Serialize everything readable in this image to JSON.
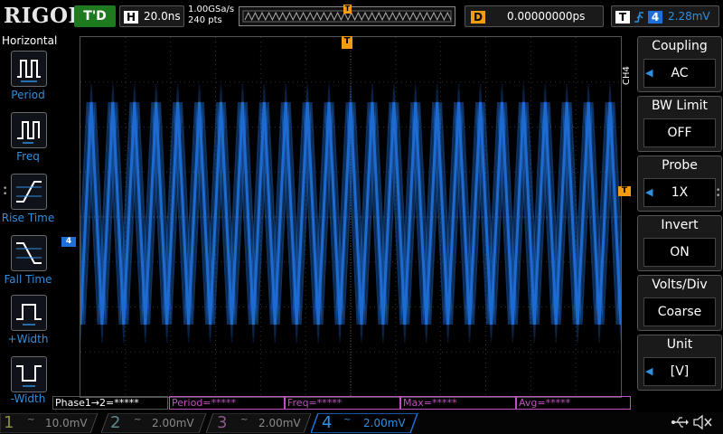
{
  "topbar": {
    "logo": "RIGOL",
    "run_status": "T'D",
    "horizontal": {
      "letter": "H",
      "timebase": "20.0ns"
    },
    "acquisition": {
      "sample_rate": "1.00GSa/s",
      "points": "240 pts"
    },
    "memory_trigger_marker": "T",
    "delay": {
      "letter": "D",
      "value": "0.00000000ps"
    },
    "trigger": {
      "letter": "T",
      "source": "4",
      "level": "2.28mV"
    }
  },
  "left_menu": {
    "title": "Horizontal",
    "items": [
      {
        "label": "Period",
        "icon": "period-icon"
      },
      {
        "label": "Freq",
        "icon": "frequency-icon"
      },
      {
        "label": "Rise Time",
        "icon": "rise-time-icon"
      },
      {
        "label": "Fall Time",
        "icon": "fall-time-icon"
      },
      {
        "label": "+Width",
        "icon": "positive-width-icon"
      },
      {
        "label": "-Width",
        "icon": "negative-width-icon"
      }
    ]
  },
  "screen": {
    "channel_marker": "4",
    "trigger_level_marker": "T",
    "trigger_position_marker": "T",
    "trace_color": "#1f6fd8",
    "waveform": {
      "shape": "triangle",
      "cycles_on_screen": 25
    }
  },
  "measurements": [
    {
      "text": "Phase1→2=*****",
      "color": "#ffffff"
    },
    {
      "text": "Period=*****",
      "color": "#c050c0"
    },
    {
      "text": "Freq=*****",
      "color": "#c050c0"
    },
    {
      "text": "Max=*****",
      "color": "#c050c0"
    },
    {
      "text": "Avg=*****",
      "color": "#c050c0"
    }
  ],
  "right_menu": {
    "channel_tab": "CH4",
    "items": [
      {
        "title": "Coupling",
        "value": "AC",
        "has_arrow": true
      },
      {
        "title": "BW Limit",
        "value": "OFF",
        "has_arrow": false
      },
      {
        "title": "Probe",
        "value": "1X",
        "has_arrow": true
      },
      {
        "title": "Invert",
        "value": "ON",
        "has_arrow": false
      },
      {
        "title": "Volts/Div",
        "value": "Coarse",
        "has_arrow": false
      },
      {
        "title": "Unit",
        "value": "[V]",
        "has_arrow": true
      }
    ]
  },
  "channels": [
    {
      "num": "1",
      "coupling": "~",
      "scale": "10.0mV",
      "color": "#5a5a30",
      "active": false
    },
    {
      "num": "2",
      "coupling": "~",
      "scale": "2.00mV",
      "color": "#3a5a5a",
      "active": false
    },
    {
      "num": "3",
      "coupling": "~",
      "scale": "2.00mV",
      "color": "#5a3a5a",
      "active": false
    },
    {
      "num": "4",
      "coupling": "~",
      "scale": "2.00mV",
      "color": "#1f6fd8",
      "active": true
    }
  ],
  "status_icons": [
    "usb-icon",
    "speaker-muted-icon"
  ]
}
